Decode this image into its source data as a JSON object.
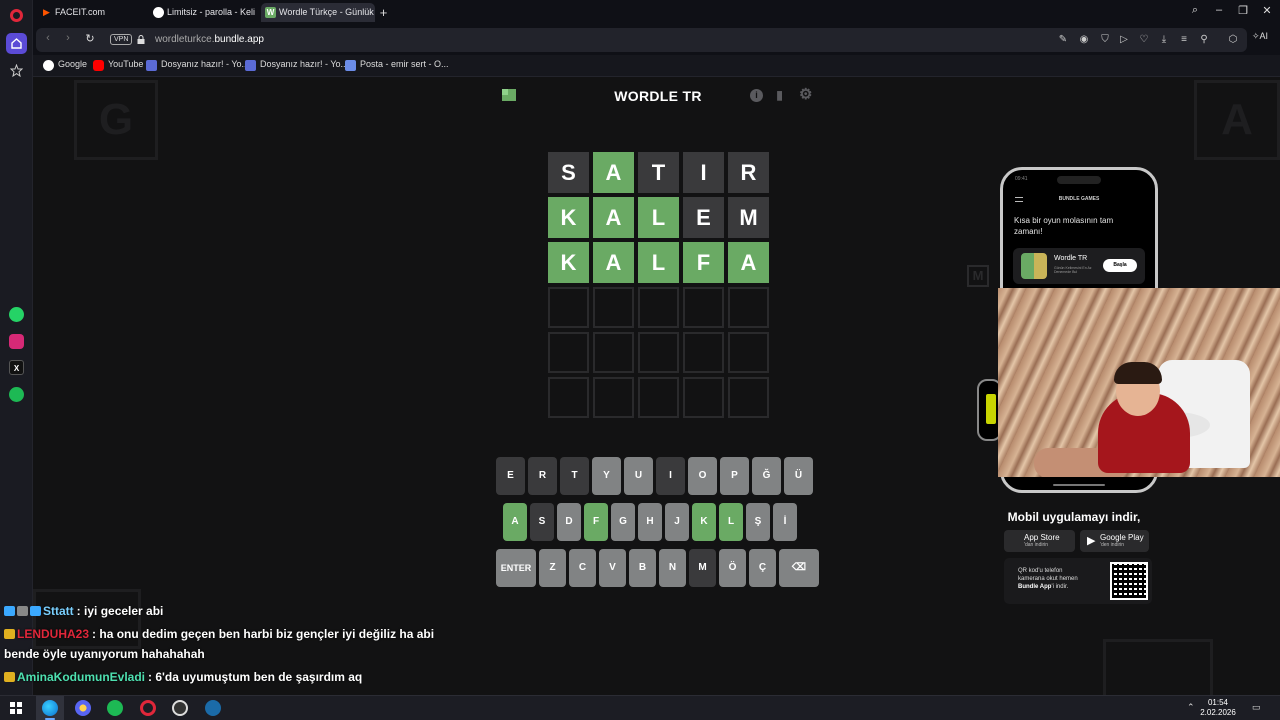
{
  "browser": {
    "tabs": [
      {
        "label": "FACEIT.com",
        "icon": "faceit-icon"
      },
      {
        "label": "Limitsiz - parolla - Kelime",
        "icon": "parolla-icon"
      },
      {
        "label": "Wordle Türkçe - Günlük K",
        "icon": "wordle-favicon",
        "active": true
      }
    ],
    "address": {
      "vpn": "VPN",
      "url_prefix": "wordleturkce.",
      "url_domain": "bundle.app"
    },
    "ai_label": "AI",
    "bookmarks": [
      {
        "label": "Google",
        "icon": "google-icon",
        "color": "#4285f4"
      },
      {
        "label": "YouTube",
        "icon": "youtube-icon",
        "color": "#ff0000"
      },
      {
        "label": "Dosyanız hazır! - Yo...",
        "icon": "bookmark-icon",
        "color": "#5b6bd6"
      },
      {
        "label": "Dosyanız hazır! - Yo...",
        "icon": "bookmark-icon",
        "color": "#5b6bd6"
      },
      {
        "label": "Posta - emir sert - O...",
        "icon": "mail-icon",
        "color": "#6b8ce8"
      }
    ]
  },
  "game": {
    "title": "WORDLE TR",
    "board": [
      [
        {
          "l": "S",
          "s": "absent"
        },
        {
          "l": "A",
          "s": "correct"
        },
        {
          "l": "T",
          "s": "absent"
        },
        {
          "l": "I",
          "s": "absent"
        },
        {
          "l": "R",
          "s": "absent"
        }
      ],
      [
        {
          "l": "K",
          "s": "correct"
        },
        {
          "l": "A",
          "s": "correct"
        },
        {
          "l": "L",
          "s": "correct"
        },
        {
          "l": "E",
          "s": "absent"
        },
        {
          "l": "M",
          "s": "absent"
        }
      ],
      [
        {
          "l": "K",
          "s": "correct"
        },
        {
          "l": "A",
          "s": "correct"
        },
        {
          "l": "L",
          "s": "correct"
        },
        {
          "l": "F",
          "s": "correct"
        },
        {
          "l": "A",
          "s": "correct"
        }
      ],
      [
        {
          "l": "",
          "s": "empty"
        },
        {
          "l": "",
          "s": "empty"
        },
        {
          "l": "",
          "s": "empty"
        },
        {
          "l": "",
          "s": "empty"
        },
        {
          "l": "",
          "s": "empty"
        }
      ],
      [
        {
          "l": "",
          "s": "empty"
        },
        {
          "l": "",
          "s": "empty"
        },
        {
          "l": "",
          "s": "empty"
        },
        {
          "l": "",
          "s": "empty"
        },
        {
          "l": "",
          "s": "empty"
        }
      ],
      [
        {
          "l": "",
          "s": "empty"
        },
        {
          "l": "",
          "s": "empty"
        },
        {
          "l": "",
          "s": "empty"
        },
        {
          "l": "",
          "s": "empty"
        },
        {
          "l": "",
          "s": "empty"
        }
      ]
    ],
    "keyboard": [
      [
        {
          "k": "E",
          "s": "absent"
        },
        {
          "k": "R",
          "s": "absent"
        },
        {
          "k": "T",
          "s": "absent"
        },
        {
          "k": "Y",
          "s": "unused"
        },
        {
          "k": "U",
          "s": "unused"
        },
        {
          "k": "I",
          "s": "absent"
        },
        {
          "k": "O",
          "s": "unused"
        },
        {
          "k": "P",
          "s": "unused"
        },
        {
          "k": "Ğ",
          "s": "unused"
        },
        {
          "k": "Ü",
          "s": "unused"
        }
      ],
      [
        {
          "k": "A",
          "s": "correct"
        },
        {
          "k": "S",
          "s": "absent"
        },
        {
          "k": "D",
          "s": "unused"
        },
        {
          "k": "F",
          "s": "correct"
        },
        {
          "k": "G",
          "s": "unused"
        },
        {
          "k": "H",
          "s": "unused"
        },
        {
          "k": "J",
          "s": "unused"
        },
        {
          "k": "K",
          "s": "correct"
        },
        {
          "k": "L",
          "s": "correct"
        },
        {
          "k": "Ş",
          "s": "unused"
        },
        {
          "k": "İ",
          "s": "unused"
        }
      ],
      [
        {
          "k": "ENTER",
          "s": "unused",
          "wide": true
        },
        {
          "k": "Z",
          "s": "unused"
        },
        {
          "k": "C",
          "s": "unused"
        },
        {
          "k": "V",
          "s": "unused"
        },
        {
          "k": "B",
          "s": "unused"
        },
        {
          "k": "N",
          "s": "unused"
        },
        {
          "k": "M",
          "s": "absent"
        },
        {
          "k": "Ö",
          "s": "unused"
        },
        {
          "k": "Ç",
          "s": "unused"
        },
        {
          "k": "⌫",
          "s": "unused",
          "back": true
        }
      ]
    ]
  },
  "phone_ad": {
    "time": "09:41",
    "brand": "BUNDLE GAMES",
    "headline": "Kısa bir oyun molasının tam zamanı!",
    "app_name": "Wordle TR",
    "app_sub": "Günün Kelimesini En Az Denemede Bul",
    "start": "Başla"
  },
  "ad_footer": {
    "cta": "Mobil uygulamayı indir,",
    "app_store": {
      "name": "App Store",
      "sub": "'dan indirin"
    },
    "google_play": {
      "name": "Google Play",
      "sub": "'den indirin"
    },
    "qr_line1": "QR kod'u telefon kamerana okut hemen",
    "qr_line2": "Bundle App",
    "qr_line3": "'i indir."
  },
  "chat": [
    {
      "user": "Sttatt",
      "sep": ":",
      "text": "iyi geceler abi",
      "color": "#7ad0ff"
    },
    {
      "user": "LENDUHA23",
      "sep": ":",
      "text": "ha onu dedim geçen ben harbi biz gençler iyi değiliz ha abi",
      "color": "#e0273a"
    },
    {
      "user": "",
      "sep": "",
      "text": "bende öyle uyanıyorum hahahahah",
      "color": "#ffffff"
    },
    {
      "user": "AminaKodumunEvladi",
      "sep": ":",
      "text": "6'da uyumuştum ben de şaşırdım aq",
      "color": "#4ee0b0"
    }
  ],
  "taskbar": {
    "time": "01:54",
    "date": "2.02.2026"
  }
}
